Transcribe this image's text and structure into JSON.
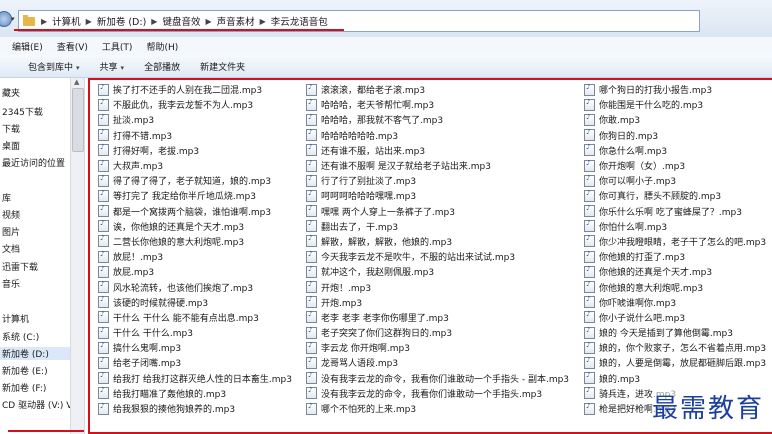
{
  "address": {
    "crumbs": [
      "计算机",
      "新加卷 (D:)",
      "键盘音效",
      "声音素材",
      "李云龙语音包"
    ],
    "separator": "▶"
  },
  "menubar": [
    "编辑(E)",
    "查看(V)",
    "工具(T)",
    "帮助(H)"
  ],
  "toolbar": {
    "include_label": "包含到库中",
    "share_label": "共享",
    "play_all_label": "全部播放",
    "new_folder_label": "新建文件夹",
    "dropdown_glyph": "▾"
  },
  "nav": {
    "items": [
      "藏夹",
      "2345下载",
      "下载",
      "桌面",
      "最近访问的位置",
      "库",
      "视频",
      "图片",
      "文档",
      "迅雷下载",
      "音乐",
      "计算机",
      "系统 (C:)",
      "新加卷 (D:)",
      "新加卷 (E:)",
      "新加卷 (F:)",
      "CD 驱动器 (V:) V"
    ],
    "selected_index": 13
  },
  "files": {
    "col1": [
      "挨了打不还手的人别在我二団混.mp3",
      "不服此仇，我李云龙誓不为人.mp3",
      "扯淡.mp3",
      "打得不错.mp3",
      "打得好啊，老拔.mp3",
      "大叔声.mp3",
      "得了得了得了，老子就知道，娘的.mp3",
      "等打完了 我定给你半斤地瓜烧.mp3",
      "都是一个窝拨两个脑袋，谁怕谁啊.mp3",
      "诶，你他娘的还真是个天才.mp3",
      "二营长你他娘的意大利炮呢.mp3",
      "放屁！.mp3",
      "放屁.mp3",
      "风水轮流转，也该他们挨炮了.mp3",
      "该硬的时候就得硬.mp3",
      "干什么 干什么 能不能有点出息.mp3",
      "干什么 干什么.mp3",
      "搞什么鬼啊.mp3",
      "给老子闭嘴.mp3",
      "给我打 给我打这群灭绝人性的日本畜生.mp3",
      "给我打瞄准了轰他娘的.mp3",
      "给我狠狠的揍他狗娘养的.mp3"
    ],
    "col2": [
      "滚滚滚，都给老子滚.mp3",
      "哈哈哈，老天爷帮忙啊.mp3",
      "哈哈哈，那我就不客气了.mp3",
      "哈哈哈哈哈哈.mp3",
      "还有谁不服，站出来.mp3",
      "还有谁不服啊 是汉子就给老子站出来.mp3",
      "行了行了别扯淡了.mp3",
      "呵呵呵哈哈哈嘿嘿.mp3",
      "嘿嘿 两个人穿上一条裤子了.mp3",
      "翻出去了，干.mp3",
      "解散，解散，解散，他娘的.mp3",
      "今天我李云龙不是吹牛，不服的站出来试试.mp3",
      "就冲这个，我赵刚佩服.mp3",
      "开炮！.mp3",
      "开炮.mp3",
      "老李 老李 老李你伤哪里了.mp3",
      "老子突突了你们这群狗日的.mp3",
      "李云龙 你开炮啊.mp3",
      "龙哥骂人语段.mp3",
      "没有我李云龙的命令，我看你们谁敢动一个手指头 - 副本.mp3",
      "没有我李云龙的命令，我看你们谁敢动一个手指头.mp3",
      "哪个不怕死的上来.mp3"
    ],
    "col3": [
      "哪个狗日的打我小报告.mp3",
      "你能围是干什么吃的.mp3",
      "你敢.mp3",
      "你狗日的.mp3",
      "你急什么啊.mp3",
      "你开炮啊（女）.mp3",
      "你可以啊小子.mp3",
      "你可真行，膘头不顾腚的.mp3",
      "你乐什么乐啊 吃了蜜蜂屎了？.mp3",
      "你怕什么啊.mp3",
      "你少冲我瞪眼睛，老子干了怎么的吧.mp3",
      "你他娘的打歪了.mp3",
      "你他娘的还真是个天才.mp3",
      "你他娘的意大利炮呢.mp3",
      "你吓唬谁啊你.mp3",
      "你小子说什么吧.mp3",
      "娘的 今天是插到了算他倒霉.mp3",
      "娘的，你个败家子，怎么不省着点用.mp3",
      "娘的，人要是倒霉，放屁都砸脚后跟.mp3",
      "娘的.mp3",
      "骑兵连，进攻.mp3",
      "枪是把好枪啊.mp3"
    ]
  },
  "watermark": "最需教育"
}
